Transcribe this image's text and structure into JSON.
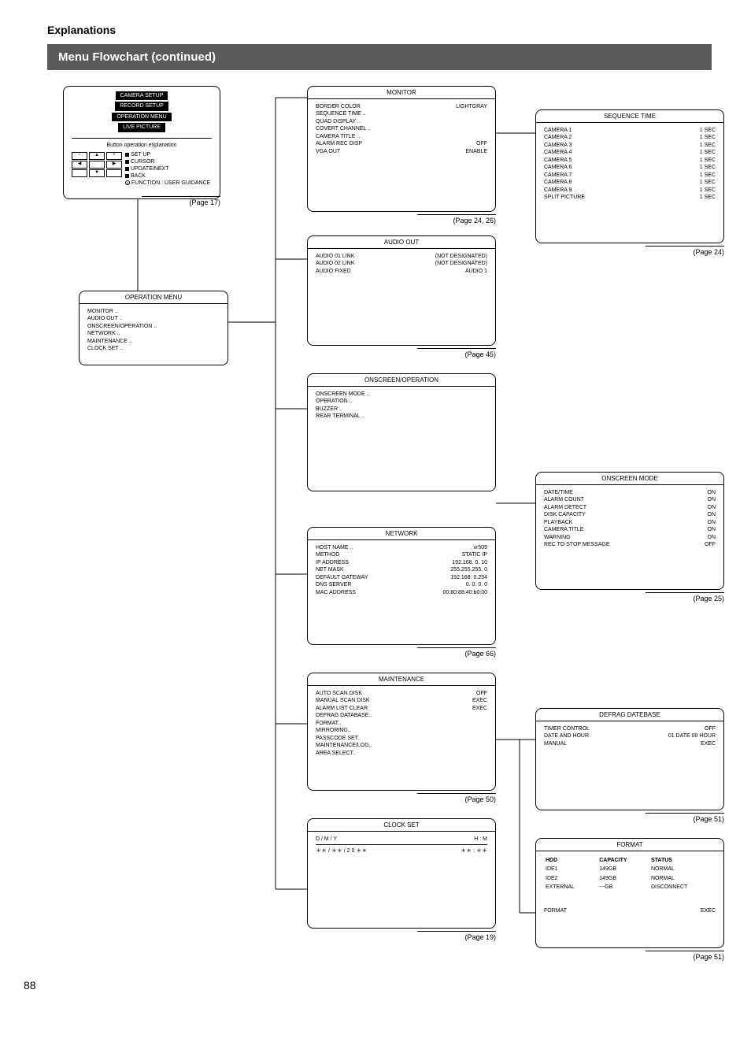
{
  "section": "Explanations",
  "title": "Menu Flowchart (continued)",
  "pageNumber": "88",
  "mainMenu": {
    "items": [
      "CAMERA SETUP",
      "RECORD SETUP",
      "OPERATION MENU",
      "LIVE PICTURE"
    ],
    "legendTitle": "Button operation explanation",
    "legend": [
      "SET UP",
      "CURSOR",
      "UPDATE/NEXT",
      "BACK",
      "FUNCTION : USER GUIDANCE"
    ],
    "ref": "(Page 17)"
  },
  "operationMenu": {
    "head": "OPERATION MENU",
    "items": [
      "MONITOR ..",
      "AUDIO OUT ..",
      "ONSCREEN/OPERATION ..",
      "NETWORK ..",
      "MAINTENANCE ..",
      "CLOCK SET .."
    ]
  },
  "monitor": {
    "head": "MONITOR",
    "rows": [
      [
        "BORDER COLOR",
        "LIGHTGRAY"
      ],
      [
        "SEQUENCE TIME ..",
        ""
      ],
      [
        "QUAD DISPLAY ..",
        ""
      ],
      [
        "COVERT CHANNEL ..",
        ""
      ],
      [
        "CAMERA TITLE ..",
        ""
      ],
      [
        "ALARM REC DISP",
        "OFF"
      ],
      [
        "VGA OUT",
        "ENABLE"
      ]
    ],
    "ref": "(Page 24, 26)"
  },
  "sequenceTime": {
    "head": "SEQUENCE TIME",
    "rows": [
      [
        "CAMERA 1",
        "1 SEC"
      ],
      [
        "CAMERA 2",
        "1 SEC"
      ],
      [
        "CAMERA 3",
        "1 SEC"
      ],
      [
        "CAMERA 4",
        "1 SEC"
      ],
      [
        "CAMERA 5",
        "1 SEC"
      ],
      [
        "CAMERA 6",
        "1 SEC"
      ],
      [
        "CAMERA 7",
        "1 SEC"
      ],
      [
        "CAMERA 8",
        "1 SEC"
      ],
      [
        "CAMERA 9",
        "1 SEC"
      ],
      [
        "SPLIT PICTURE",
        "1 SEC"
      ]
    ],
    "ref": "(Page 24)"
  },
  "audioOut": {
    "head": "AUDIO OUT",
    "rows": [
      [
        "AUDIO 01 LINK",
        "(NOT DESIGNATED)"
      ],
      [
        "AUDIO 02 LINK",
        "(NOT DESIGNATED)"
      ],
      [
        "AUDIO FIXED",
        "AUDIO 1"
      ]
    ],
    "ref": "(Page 45)"
  },
  "onscreenOp": {
    "head": "ONSCREEN/OPERATION",
    "items": [
      "ONSCREEN MODE ..",
      "OPERATION ..",
      "BUZZER ..",
      "REAR TERMINAL .."
    ]
  },
  "onscreenMode": {
    "head": "ONSCREEN MODE",
    "rows": [
      [
        "DATE/TIME",
        "ON"
      ],
      [
        "ALARM COUNT",
        "ON"
      ],
      [
        "ALARM DETECT",
        "ON"
      ],
      [
        "DISK CAPACITY",
        "ON"
      ],
      [
        "PLAYBACK",
        "ON"
      ],
      [
        "CAMERA TITLE",
        "ON"
      ],
      [
        "WARNING",
        "ON"
      ],
      [
        "REC TO STOP MESSAGE",
        "OFF"
      ]
    ],
    "ref": "(Page 25)"
  },
  "network": {
    "head": "NETWORK",
    "rows": [
      [
        "HOST NAME ..",
        "vr509"
      ],
      [
        "METHOD",
        "STATIC IP"
      ],
      [
        "IP ADDRESS",
        "192.168.  0. 10"
      ],
      [
        "NET MASK",
        "255.255.255.  0"
      ],
      [
        "DEFAULT GATEWAY",
        "192.168.  0.254"
      ],
      [
        "DNS SERVER",
        "0.  0.  0.  0"
      ],
      [
        "",
        ""
      ],
      [
        "MAC ADDRESS",
        "00:80:88:40:b0:00"
      ]
    ],
    "ref": "(Page 66)"
  },
  "maintenance": {
    "head": "MAINTENANCE",
    "rows": [
      [
        "AUTO SCAN DISK",
        "OFF"
      ],
      [
        "MANUAL SCAN DISK",
        "EXEC"
      ],
      [
        "ALARM LIST CLEAR",
        "EXEC"
      ],
      [
        "DEFRAG DATABASE..",
        ""
      ],
      [
        "FORMAT..",
        ""
      ],
      [
        "MIRRORING..",
        ""
      ],
      [
        "PASSCODE SET..",
        ""
      ],
      [
        "MAINTENANCE/LOG..",
        ""
      ],
      [
        "AREA SELECT..",
        ""
      ]
    ],
    "ref": "(Page 50)"
  },
  "defrag": {
    "head": "DEFRAG DATEBASE",
    "rows": [
      [
        "TIMER CONTROL",
        "OFF"
      ],
      [
        "DATE AND HOUR",
        "01 DATE 00 HOUR"
      ],
      [
        "",
        ""
      ],
      [
        "MANUAL",
        "EXEC"
      ]
    ],
    "ref": "(Page 51)"
  },
  "clockSet": {
    "head": "CLOCK SET",
    "header": [
      "D /  M   /   Y",
      "H : M"
    ],
    "values": [
      "＊＊ / ＊＊ / 2 0 ＊＊",
      "＊＊ : ＊＊"
    ],
    "ref": "(Page 19)"
  },
  "format": {
    "head": "FORMAT",
    "tblHead": [
      "HDD",
      "CAPACITY",
      "STATUS"
    ],
    "tblRows": [
      [
        "IDE1",
        "149GB",
        "NORMAL"
      ],
      [
        "IDE2",
        "149GB",
        "NORMAL"
      ],
      [
        "EXTERNAL",
        "---GB",
        "DISCONNECT"
      ]
    ],
    "bottom": [
      "FORMAT",
      "EXEC"
    ],
    "ref": "(Page 51)"
  }
}
